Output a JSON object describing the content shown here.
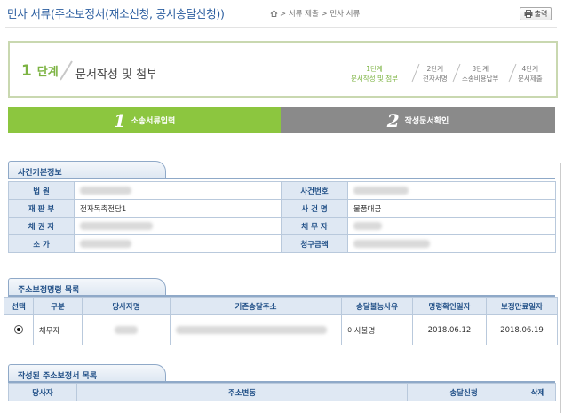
{
  "header": {
    "title": "민사 서류(주소보정서(재소신청, 공시송달신청))",
    "breadcrumb": "> 서류 제출 > 민사 서류",
    "print_label": "출력"
  },
  "step": {
    "current_number": "1",
    "current_unit": "단계",
    "current_name": "문서작성 및 첨부",
    "mini_steps": [
      {
        "num": "1단계",
        "name": "문서작성 및 첨부",
        "active": true
      },
      {
        "num": "2단계",
        "name": "전자서명",
        "active": false
      },
      {
        "num": "3단계",
        "name": "소송비용납부",
        "active": false
      },
      {
        "num": "4단계",
        "name": "문서제출",
        "active": false
      }
    ]
  },
  "progress": {
    "step1_num": "1",
    "step1_label": "소송서류입력",
    "step2_num": "2",
    "step2_label": "작성문서확인",
    "active_color": "#8cc63f",
    "inactive_color": "#8a8a8a"
  },
  "case_info": {
    "section_title": "사건기본정보",
    "rows": [
      {
        "l1": "법 원",
        "v1": "",
        "l2": "사건번호",
        "v2": ""
      },
      {
        "l1": "재 판 부",
        "v1": "전자독촉전담1",
        "l2": "사 건 명",
        "v2": "물품대금"
      },
      {
        "l1": "채 권 자",
        "v1": "",
        "l2": "채 무 자",
        "v2": ""
      },
      {
        "l1": "소 가",
        "v1": "",
        "l2": "청구금액",
        "v2": ""
      }
    ]
  },
  "order_list": {
    "section_title": "주소보정명령 목록",
    "headers": [
      "선택",
      "구분",
      "당사자명",
      "기존송달주소",
      "송달불능사유",
      "명령확인일자",
      "보정만료일자"
    ],
    "rows": [
      {
        "type": "채무자",
        "name": "",
        "address": "",
        "reason": "이사불명",
        "confirm_date": "2018.06.12",
        "expire_date": "2018.06.19"
      }
    ]
  },
  "written_list": {
    "section_title": "작성된 주소보정서 목록",
    "headers": [
      "당사자",
      "주소변동",
      "송달신청",
      "삭제"
    ]
  }
}
